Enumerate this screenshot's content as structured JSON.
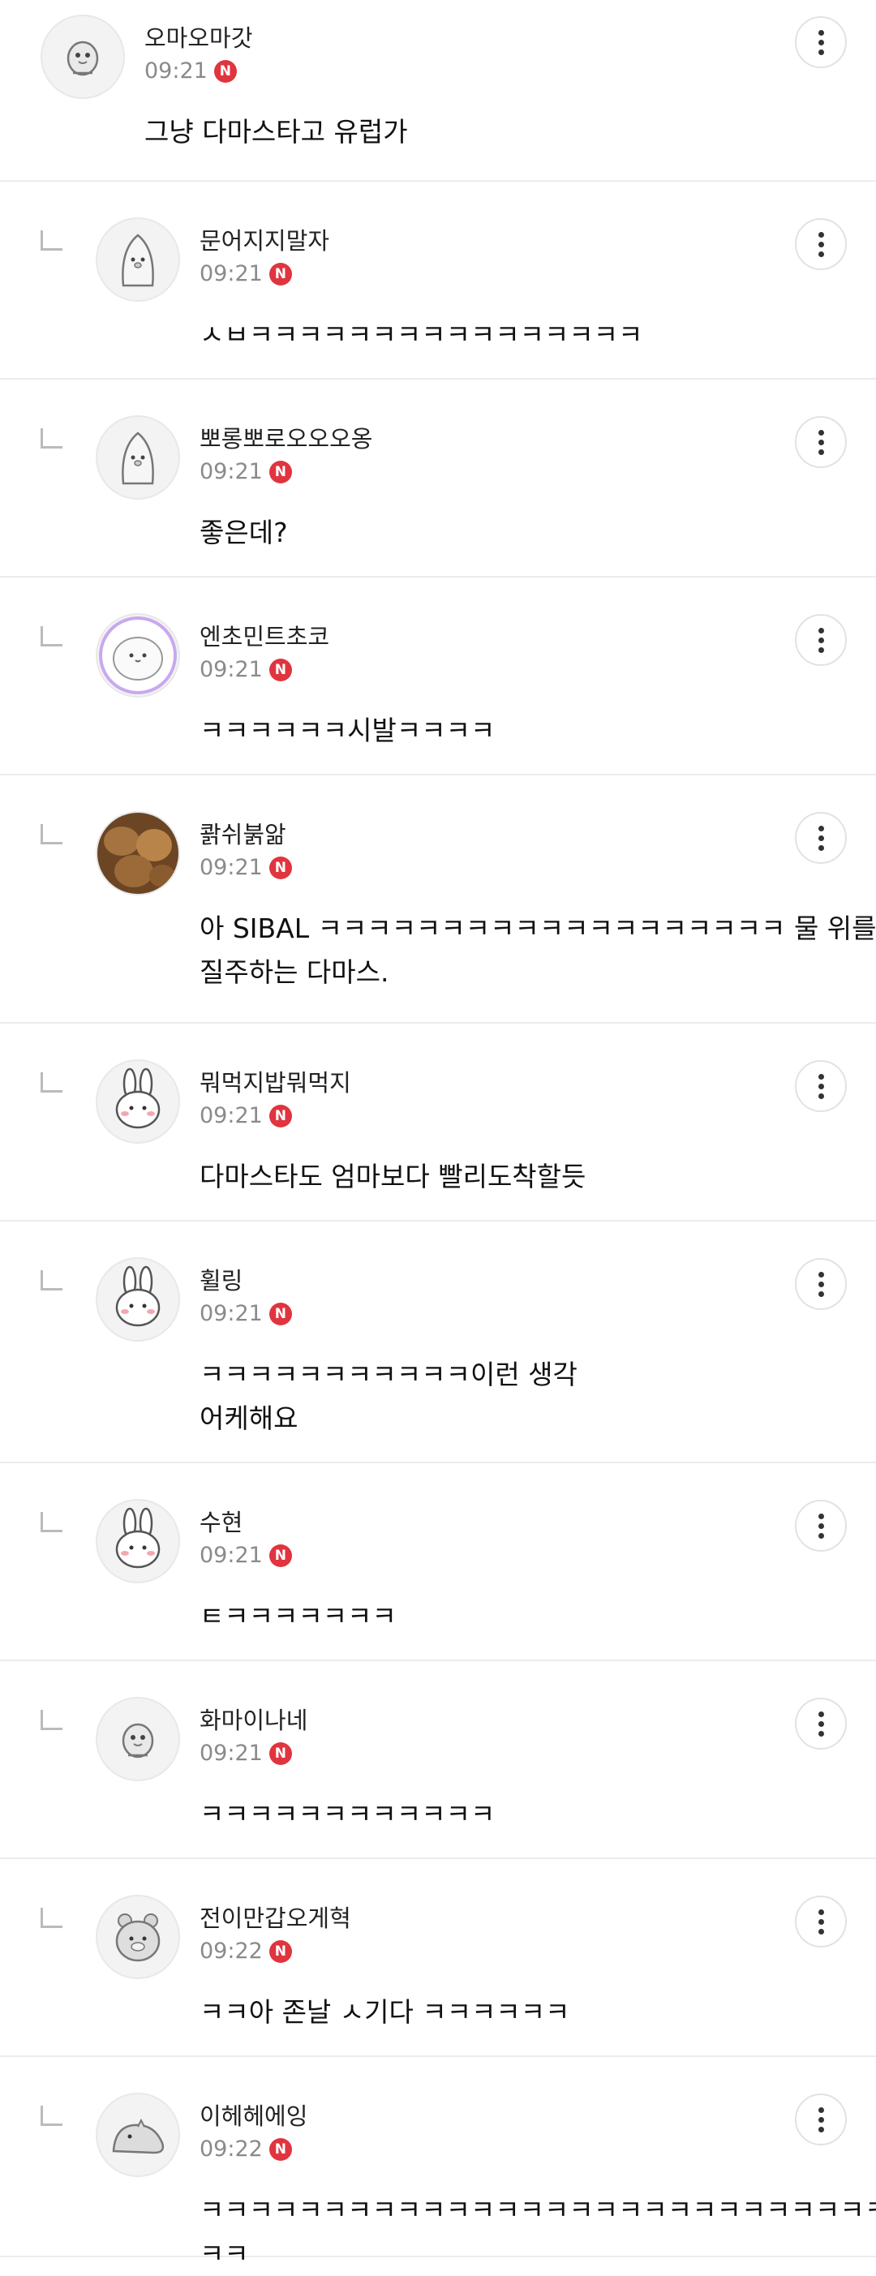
{
  "badge_label": "N",
  "comments": [
    {
      "nickname": "오마오마갓",
      "time": "09:21",
      "text": "그냥 다마스타고 유럽가",
      "reply": false,
      "avatar": "chick-icon"
    },
    {
      "nickname": "문어지지말자",
      "time": "09:21",
      "text": "ㅅㅂㅋㅋㅋㅋㅋㅋㅋㅋㅋㅋㅋㅋㅋㅋㅋㅋ",
      "reply": true,
      "avatar": "penguin-icon"
    },
    {
      "nickname": "뽀롱뽀로오오오옹",
      "time": "09:21",
      "text": "좋은데?",
      "reply": true,
      "avatar": "penguin-icon"
    },
    {
      "nickname": "엔초민트초코",
      "time": "09:21",
      "text": "ㅋㅋㅋㅋㅋㅋ시발ㅋㅋㅋㅋ",
      "reply": true,
      "avatar": "blob-icon"
    },
    {
      "nickname": "콹쉬붉앎",
      "time": "09:21",
      "text": "아 SIBAL ㅋㅋㅋㅋㅋㅋㅋㅋㅋㅋㅋㅋㅋㅋㅋㅋㅋㅋㅋ 물 위를 질주하는 다마스.",
      "reply": true,
      "avatar": "walnut-icon"
    },
    {
      "nickname": "뭐먹지밥뭐먹지",
      "time": "09:21",
      "text": "다마스타도 엄마보다 빨리도착할듯",
      "reply": true,
      "avatar": "rabbit-icon"
    },
    {
      "nickname": "휠링",
      "time": "09:21",
      "text": "ㅋㅋㅋㅋㅋㅋㅋㅋㅋㅋㅋ이런 생각\n어케해요",
      "reply": true,
      "avatar": "rabbit-icon"
    },
    {
      "nickname": "수현",
      "time": "09:21",
      "text": "ㅌㅋㅋㅋㅋㅋㅋㅋ",
      "reply": true,
      "avatar": "rabbit-icon"
    },
    {
      "nickname": "화마이나네",
      "time": "09:21",
      "text": "ㅋㅋㅋㅋㅋㅋㅋㅋㅋㅋㅋㅋ",
      "reply": true,
      "avatar": "chick-icon"
    },
    {
      "nickname": "전이만갑오게혁",
      "time": "09:22",
      "text": "ㅋㅋ아 존날 ㅅ기다 ㅋㅋㅋㅋㅋㅋ",
      "reply": true,
      "avatar": "bear-icon"
    },
    {
      "nickname": "이헤헤에잉",
      "time": "09:22",
      "text": "ㅋㅋㅋㅋㅋㅋㅋㅋㅋㅋㅋㅋㅋㅋㅋㅋㅋㅋㅋㅋㅋㅋㅋㅋㅋㅋㅋㅋㅋㅋ",
      "reply": true,
      "avatar": "dino-icon"
    }
  ]
}
